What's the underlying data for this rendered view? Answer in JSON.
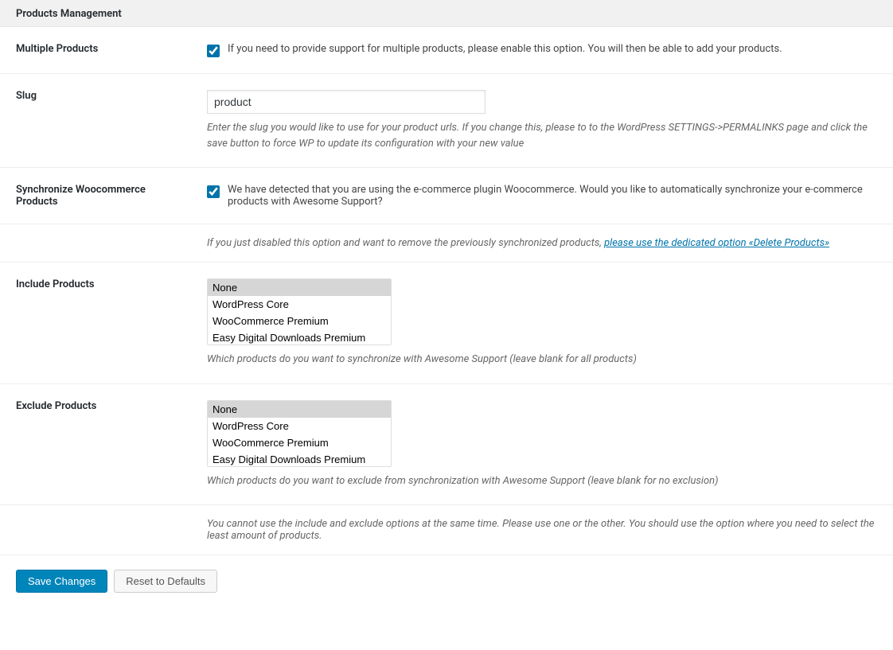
{
  "header": {
    "title": "Products Management"
  },
  "fields": {
    "multiple_products": {
      "label": "Multiple Products",
      "text": "If you need to provide support for multiple products, please enable this option. You will then be able to add your products."
    },
    "slug": {
      "label": "Slug",
      "value": "product",
      "description": "Enter the slug you would like to use for your product urls. If you change this, please to to the WordPress SETTINGS->PERMALINKS page and click the save button to force WP to update its configuration with your new value"
    },
    "sync_woo": {
      "label": "Synchronize Woocommerce Products",
      "text": "We have detected that you are using the e-commerce plugin Woocommerce. Would you like to automatically synchronize your e-commerce products with Awesome Support?"
    },
    "disabled_note": {
      "text": "If you just disabled this option and want to remove the previously synchronized products, ",
      "link_text": "please use the dedicated option «Delete Products»"
    },
    "include": {
      "label": "Include Products",
      "description": "Which products do you want to synchronize with Awesome Support (leave blank for all products)"
    },
    "exclude": {
      "label": "Exclude Products",
      "description": "Which products do you want to exclude from synchronization with Awesome Support (leave blank for no exclusion)"
    },
    "mutual_note": {
      "text": "You cannot use the include and exclude options at the same time. Please use one or the other. You should use the option where you need to select the least amount of products."
    }
  },
  "product_options": [
    "None",
    "WordPress Core",
    "WooCommerce Premium",
    "Easy Digital Downloads Premium"
  ],
  "buttons": {
    "save": "Save Changes",
    "reset": "Reset to Defaults"
  }
}
